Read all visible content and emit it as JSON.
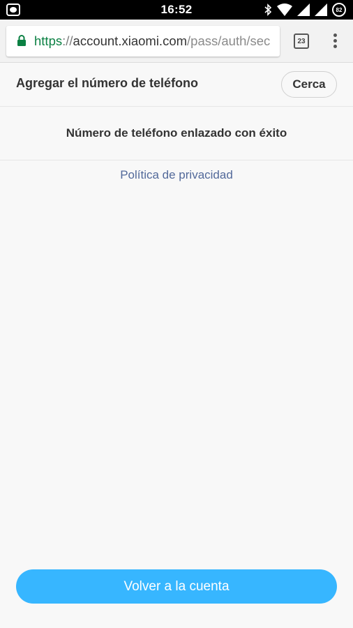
{
  "status_bar": {
    "time": "16:52",
    "battery_level": "82"
  },
  "browser": {
    "url_scheme": "https",
    "url_separator": "://",
    "url_host": "account.xiaomi.com",
    "url_path": "/pass/auth/sec",
    "tab_count": "23"
  },
  "page": {
    "title": "Agregar el número de teléfono",
    "close_label": "Cerca",
    "success_message": "Número de teléfono enlazado con éxito",
    "privacy_link": "Política de privacidad",
    "return_button": "Volver a la cuenta"
  },
  "colors": {
    "accent": "#37b6ff",
    "link": "#52699a",
    "secure_green": "#0b8043"
  }
}
